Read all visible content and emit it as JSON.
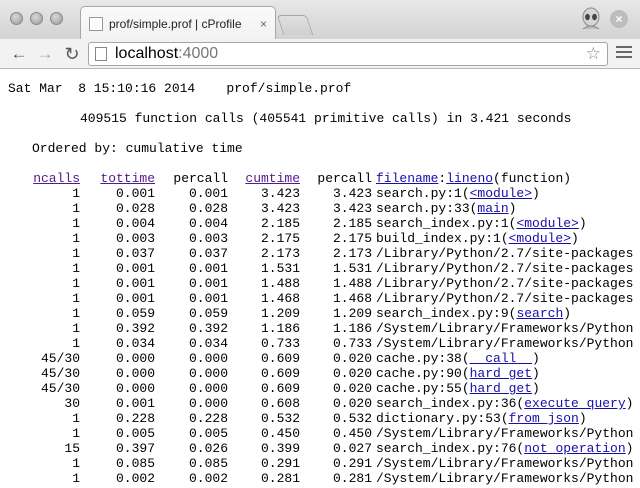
{
  "browser": {
    "tab_title": "prof/simple.prof | cProfile",
    "tab_close": "×",
    "url_host": "localhost",
    "url_port": ":4000"
  },
  "report": {
    "date_line": "Sat Mar  8 15:10:16 2014    prof/simple.prof",
    "calls_line": "409515 function calls (405541 primitive calls) in 3.421 seconds",
    "order_line": "Ordered by: cumulative time"
  },
  "table": {
    "headers": {
      "ncalls": "ncalls",
      "tottime": "tottime",
      "percall1": "percall",
      "cumtime": "cumtime",
      "percall2": "percall",
      "filename": "filename",
      "colon": ":",
      "lineno": "lineno",
      "function": "(function)"
    },
    "rows": [
      {
        "ncalls": "1",
        "tottime": "0.001",
        "percall1": "0.001",
        "cumtime": "3.423",
        "percall2": "3.423",
        "pre": "search.py:1(",
        "link": "<module>",
        "post": ")"
      },
      {
        "ncalls": "1",
        "tottime": "0.028",
        "percall1": "0.028",
        "cumtime": "3.423",
        "percall2": "3.423",
        "pre": "search.py:33(",
        "link": "main",
        "post": ")"
      },
      {
        "ncalls": "1",
        "tottime": "0.004",
        "percall1": "0.004",
        "cumtime": "2.185",
        "percall2": "2.185",
        "pre": "search_index.py:1(",
        "link": "<module>",
        "post": ")"
      },
      {
        "ncalls": "1",
        "tottime": "0.003",
        "percall1": "0.003",
        "cumtime": "2.175",
        "percall2": "2.175",
        "pre": "build_index.py:1(",
        "link": "<module>",
        "post": ")"
      },
      {
        "ncalls": "1",
        "tottime": "0.037",
        "percall1": "0.037",
        "cumtime": "2.173",
        "percall2": "2.173",
        "pre": "/Library/Python/2.7/site-packages",
        "link": "",
        "post": ""
      },
      {
        "ncalls": "1",
        "tottime": "0.001",
        "percall1": "0.001",
        "cumtime": "1.531",
        "percall2": "1.531",
        "pre": "/Library/Python/2.7/site-packages",
        "link": "",
        "post": ""
      },
      {
        "ncalls": "1",
        "tottime": "0.001",
        "percall1": "0.001",
        "cumtime": "1.488",
        "percall2": "1.488",
        "pre": "/Library/Python/2.7/site-packages",
        "link": "",
        "post": ""
      },
      {
        "ncalls": "1",
        "tottime": "0.001",
        "percall1": "0.001",
        "cumtime": "1.468",
        "percall2": "1.468",
        "pre": "/Library/Python/2.7/site-packages",
        "link": "",
        "post": ""
      },
      {
        "ncalls": "1",
        "tottime": "0.059",
        "percall1": "0.059",
        "cumtime": "1.209",
        "percall2": "1.209",
        "pre": "search_index.py:9(",
        "link": "search",
        "post": ")"
      },
      {
        "ncalls": "1",
        "tottime": "0.392",
        "percall1": "0.392",
        "cumtime": "1.186",
        "percall2": "1.186",
        "pre": "/System/Library/Frameworks/Python",
        "link": "",
        "post": ""
      },
      {
        "ncalls": "1",
        "tottime": "0.034",
        "percall1": "0.034",
        "cumtime": "0.733",
        "percall2": "0.733",
        "pre": "/System/Library/Frameworks/Python",
        "link": "",
        "post": ""
      },
      {
        "ncalls": "45/30",
        "tottime": "0.000",
        "percall1": "0.000",
        "cumtime": "0.609",
        "percall2": "0.020",
        "pre": "cache.py:38(",
        "link": "__call__",
        "post": ")"
      },
      {
        "ncalls": "45/30",
        "tottime": "0.000",
        "percall1": "0.000",
        "cumtime": "0.609",
        "percall2": "0.020",
        "pre": "cache.py:90(",
        "link": "hard_get",
        "post": ")"
      },
      {
        "ncalls": "45/30",
        "tottime": "0.000",
        "percall1": "0.000",
        "cumtime": "0.609",
        "percall2": "0.020",
        "pre": "cache.py:55(",
        "link": "hard_get",
        "post": ")"
      },
      {
        "ncalls": "30",
        "tottime": "0.001",
        "percall1": "0.000",
        "cumtime": "0.608",
        "percall2": "0.020",
        "pre": "search_index.py:36(",
        "link": "execute_query",
        "post": ")"
      },
      {
        "ncalls": "1",
        "tottime": "0.228",
        "percall1": "0.228",
        "cumtime": "0.532",
        "percall2": "0.532",
        "pre": "dictionary.py:53(",
        "link": "from_json",
        "post": ")"
      },
      {
        "ncalls": "1",
        "tottime": "0.005",
        "percall1": "0.005",
        "cumtime": "0.450",
        "percall2": "0.450",
        "pre": "/System/Library/Frameworks/Python",
        "link": "",
        "post": ""
      },
      {
        "ncalls": "15",
        "tottime": "0.397",
        "percall1": "0.026",
        "cumtime": "0.399",
        "percall2": "0.027",
        "pre": "search_index.py:76(",
        "link": "not_operation",
        "post": ")"
      },
      {
        "ncalls": "1",
        "tottime": "0.085",
        "percall1": "0.085",
        "cumtime": "0.291",
        "percall2": "0.291",
        "pre": "/System/Library/Frameworks/Python",
        "link": "",
        "post": ""
      },
      {
        "ncalls": "1",
        "tottime": "0.002",
        "percall1": "0.002",
        "cumtime": "0.281",
        "percall2": "0.281",
        "pre": "/System/Library/Frameworks/Python",
        "link": "",
        "post": ""
      }
    ]
  }
}
